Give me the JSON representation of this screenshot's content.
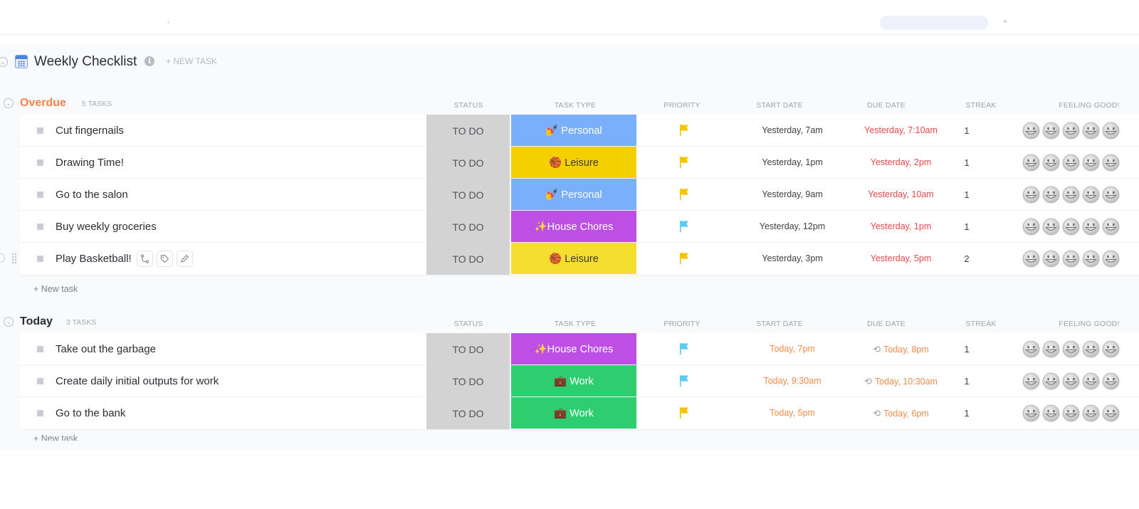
{
  "list": {
    "title": "Weekly Checklist",
    "new_task_label": "+ NEW TASK"
  },
  "columns": {
    "status": "STATUS",
    "task_type": "TASK TYPE",
    "priority": "PRIORITY",
    "start_date": "START DATE",
    "due_date": "DUE DATE",
    "streak": "STREAK",
    "feeling_good": "FEELING GOOD!"
  },
  "colors": {
    "overdue": "#f5834d",
    "today": "#2a2e34",
    "personal": "#7ab0fb",
    "leisure": "#f5d000",
    "house_chores": "#bd4fe5",
    "work": "#2ecd6f",
    "flag_yellow": "#f5c400",
    "flag_blue": "#5dc9f5"
  },
  "groups": [
    {
      "name": "Overdue",
      "count_label": "5 TASKS",
      "add_task_label": "+ New task",
      "tasks": [
        {
          "name": "Cut fingernails",
          "status": "TO DO",
          "type": "💅 Personal",
          "type_key": "personal",
          "priority_flag": "yellow",
          "start": "Yesterday, 7am",
          "due": "Yesterday, 7:10am",
          "due_repeat": false,
          "streak": "1"
        },
        {
          "name": "Drawing Time!",
          "status": "TO DO",
          "type": "🏀 Leisure",
          "type_key": "leisure",
          "priority_flag": "yellow",
          "start": "Yesterday, 1pm",
          "due": "Yesterday, 2pm",
          "due_repeat": false,
          "streak": "1"
        },
        {
          "name": "Go to the salon",
          "status": "TO DO",
          "type": "💅 Personal",
          "type_key": "personal",
          "priority_flag": "yellow",
          "start": "Yesterday, 9am",
          "due": "Yesterday, 10am",
          "due_repeat": false,
          "streak": "1"
        },
        {
          "name": "Buy weekly groceries",
          "status": "TO DO",
          "type": "✨House Chores",
          "type_key": "house_chores",
          "priority_flag": "blue",
          "start": "Yesterday, 12pm",
          "due": "Yesterday, 1pm",
          "due_repeat": false,
          "streak": "1"
        },
        {
          "name": "Play Basketball!",
          "status": "TO DO",
          "type": "🏀 Leisure",
          "type_key": "leisure",
          "priority_flag": "yellow",
          "start": "Yesterday, 3pm",
          "due": "Yesterday, 5pm",
          "due_repeat": false,
          "streak": "2",
          "hovered": true
        }
      ]
    },
    {
      "name": "Today",
      "count_label": "3 TASKS",
      "add_task_label": "+ New task",
      "tasks": [
        {
          "name": "Take out the garbage",
          "status": "TO DO",
          "type": "✨House Chores",
          "type_key": "house_chores",
          "priority_flag": "blue",
          "start": "Today, 7pm",
          "due": "Today, 8pm",
          "due_repeat": true,
          "streak": "1"
        },
        {
          "name": "Create daily initial outputs for work",
          "status": "TO DO",
          "type": "💼 Work",
          "type_key": "work",
          "priority_flag": "blue",
          "start": "Today, 9:30am",
          "due": "Today, 10:30am",
          "due_repeat": true,
          "streak": "1"
        },
        {
          "name": "Go to the bank",
          "status": "TO DO",
          "type": "💼 Work",
          "type_key": "work",
          "priority_flag": "yellow",
          "start": "Today, 5pm",
          "due": "Today, 6pm",
          "due_repeat": true,
          "streak": "1"
        }
      ]
    }
  ]
}
